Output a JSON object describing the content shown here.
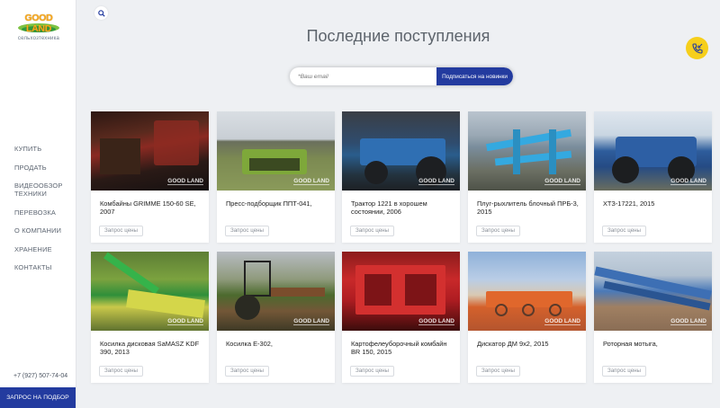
{
  "logo": {
    "word": "GOOD LAND",
    "subtitle": "сельхозтехника"
  },
  "nav": [
    {
      "label": "КУПИТЬ"
    },
    {
      "label": "ПРОДАТЬ"
    },
    {
      "label": "ВИДЕООБЗОР ТЕХНИКИ"
    },
    {
      "label": "ПЕРЕВОЗКА"
    },
    {
      "label": "О КОМПАНИИ"
    },
    {
      "label": "ХРАНЕНИЕ"
    },
    {
      "label": "КОНТАКТЫ"
    }
  ],
  "phone": "+7 (927) 507-74-04",
  "cta_button": "ЗАПРОС НА ПОДБОР",
  "page_title": "Последние поступления",
  "subscribe": {
    "placeholder": "*Ваш email",
    "button": "Подписаться на новинки"
  },
  "watermark": "GOOD LAND",
  "price_button": "Запрос цены",
  "cards": [
    {
      "title": "Комбайны GRIMME 150-60 SE, 2007"
    },
    {
      "title": "Пресс-подборщик ППТ-041,"
    },
    {
      "title": "Трактор 1221 в хорошем состоянии, 2006"
    },
    {
      "title": "Плуг-рыхлитель блочный ПРБ-3, 2015"
    },
    {
      "title": "ХТЗ-17221, 2015"
    },
    {
      "title": "Косилка дисковая SaMASZ KDF 390, 2013"
    },
    {
      "title": "Косилка Е-302,"
    },
    {
      "title": "Картофелеуборочный комбайн BR 150, 2015"
    },
    {
      "title": "Дискатор ДМ 9х2, 2015"
    },
    {
      "title": "Роторная мотыга,"
    }
  ],
  "colors": {
    "accent": "#233b9f",
    "call": "#f6cf1b",
    "logo_orange": "#f7a81b",
    "logo_green": "#2e9a3f"
  }
}
